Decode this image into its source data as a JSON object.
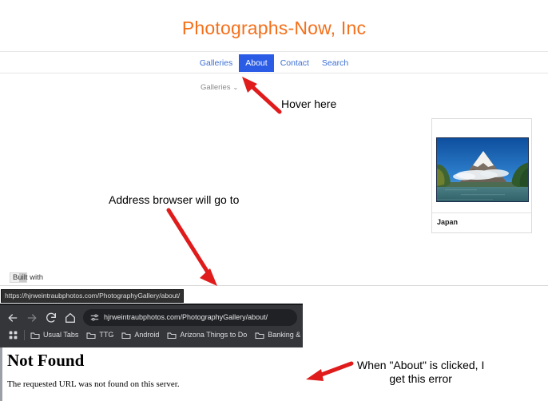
{
  "site": {
    "title": "Photographs-Now, Inc",
    "title_color": "#f4701b",
    "nav": [
      {
        "label": "Galleries",
        "active": false
      },
      {
        "label": "About",
        "active": true
      },
      {
        "label": "Contact",
        "active": false
      },
      {
        "label": "Search",
        "active": false
      }
    ],
    "active_nav_bg": "#2b5ce6",
    "nav_link_color": "#3b6fd4",
    "subnav": {
      "label": "Galleries",
      "caret": "⌄"
    },
    "gallery_card": {
      "caption": "Japan",
      "image_alt": "mount-fuji-lake-photo"
    },
    "footer": {
      "built_with": "Built with"
    },
    "status_url": "https://hjrweintraubphotos.com/PhotographyGallery/about/"
  },
  "browser": {
    "icons": {
      "back": "back-arrow-icon",
      "forward": "forward-arrow-icon",
      "reload": "reload-icon",
      "home": "home-icon",
      "site_settings": "site-settings-icon",
      "apps": "apps-grid-icon"
    },
    "address": "hjrweintraubphotos.com/PhotographyGallery/about/",
    "bookmarks": [
      {
        "label": "Usual Tabs"
      },
      {
        "label": "TTG"
      },
      {
        "label": "Android"
      },
      {
        "label": "Arizona Things to Do"
      },
      {
        "label": "Banking & Financ"
      }
    ],
    "page": {
      "heading": "Not Found",
      "body": "The requested URL was not found on this server."
    }
  },
  "annotations": {
    "arrow_color": "#e01b1b",
    "hover": "Hover here",
    "address": "Address browser will go to",
    "error": "When \"About\" is clicked, I\nget this error"
  }
}
